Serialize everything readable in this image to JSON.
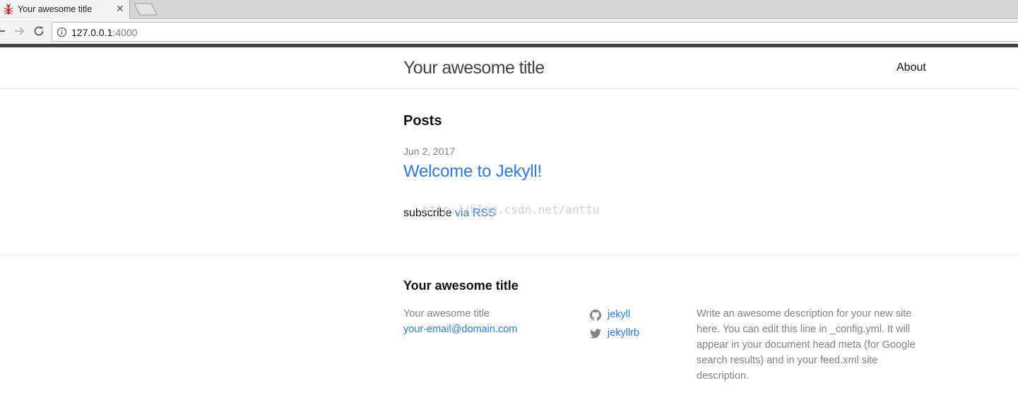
{
  "browser": {
    "tab_title": "Your awesome title",
    "tab_close": "✕",
    "url_host": "127.0.0.1",
    "url_port": ":4000"
  },
  "header": {
    "site_title": "Your awesome title",
    "nav": [
      {
        "label": "About"
      }
    ]
  },
  "main": {
    "heading": "Posts",
    "posts": [
      {
        "date": "Jun 2, 2017",
        "title": "Welcome to Jekyll!"
      }
    ],
    "subscribe_prefix": "subscribe ",
    "subscribe_link": "via RSS",
    "watermark": "http://blog.csdn.net/anttu"
  },
  "footer": {
    "heading": "Your awesome title",
    "name": "Your awesome title",
    "email": "your-email@domain.com",
    "social": [
      {
        "icon": "github-icon",
        "label": "jekyll"
      },
      {
        "icon": "twitter-icon",
        "label": "jekyllrb"
      }
    ],
    "description": "Write an awesome description for your new site here. You can edit this line in _config.yml. It will appear in your document head meta (for Google search results) and in your feed.xml site description."
  },
  "colors": {
    "link": "#2a7ae2",
    "muted": "#828282",
    "title": "#424242",
    "top_bar": "#424242"
  }
}
